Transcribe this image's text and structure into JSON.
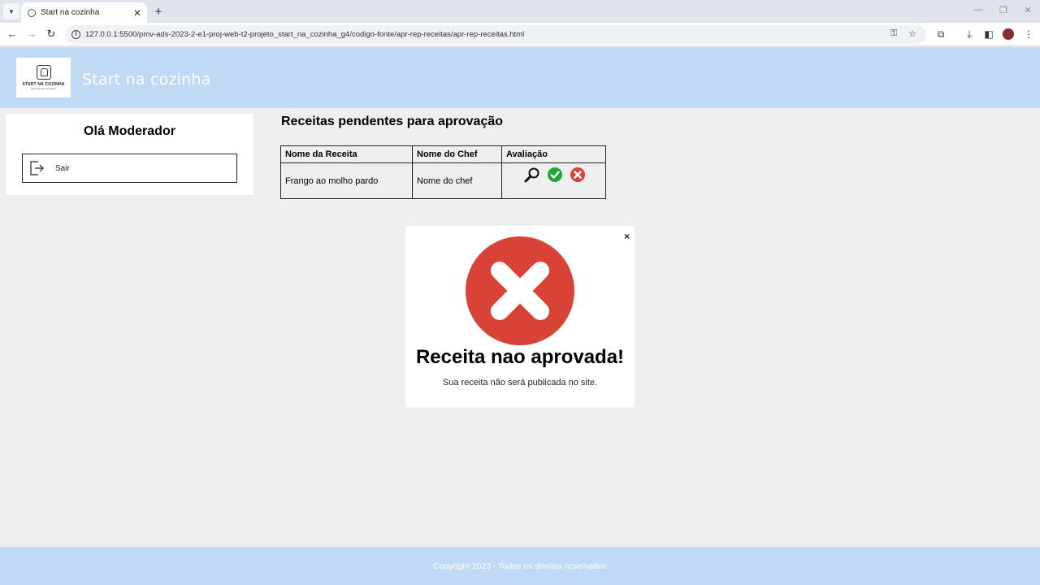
{
  "browser": {
    "tab_title": "Start na cozinha",
    "url": "127.0.0.1:5500/pmv-ads-2023-2-e1-proj-web-t2-projeto_start_na_cozinha_g4/codigo-fonte/apr-rep-receitas/apr-rep-receitas.html"
  },
  "header": {
    "logo_text": "START NA COZINHA",
    "logo_sub": "aprendendo a cozinhar",
    "site_title": "Start na cozinha"
  },
  "sidebar": {
    "greeting": "Olá Moderador",
    "logout_label": "Sair"
  },
  "main": {
    "title": "Receitas pendentes para aprovação",
    "table": {
      "headers": [
        "Nome da Receita",
        "Nome do Chef",
        "Avaliação"
      ],
      "rows": [
        {
          "recipe": "Frango ao molho pardo",
          "chef": "Nome do chef"
        }
      ]
    }
  },
  "modal": {
    "close": "×",
    "title": "Receita nao aprovada!",
    "message": "Sua receita não será publicada no site."
  },
  "footer": {
    "text": "Copyright 2023 - Todos os direitos reservados"
  },
  "colors": {
    "header_bg": "#c0daf5",
    "approve_green": "#1fa83a",
    "reject_red": "#d94236",
    "page_bg": "#efefef"
  },
  "icons": [
    "search-icon",
    "approve-icon",
    "reject-icon",
    "logout-icon",
    "reject-large-icon"
  ]
}
